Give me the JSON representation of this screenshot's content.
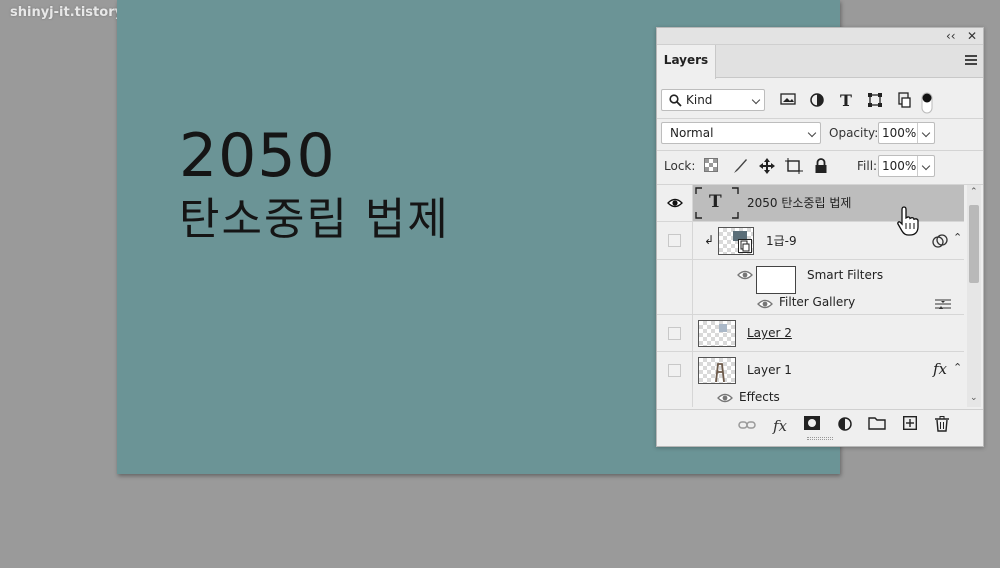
{
  "watermark": "shinyj-it.tistory.com",
  "canvas": {
    "line1": "2050",
    "line2": "탄소중립 법제",
    "background": "#6b9496"
  },
  "panel": {
    "collapse_glyph": "‹‹",
    "close_glyph": "✕",
    "tab_label": "Layers",
    "filter": {
      "kind_label": "Kind",
      "icons": [
        "image-filter-icon",
        "adjustment-filter-icon",
        "type-filter-icon",
        "shape-filter-icon",
        "smart-object-filter-icon",
        "filter-toggle-icon"
      ]
    },
    "blend_mode": "Normal",
    "opacity_label": "Opacity:",
    "opacity_value": "100%",
    "lock_label": "Lock:",
    "fill_label": "Fill:",
    "fill_value": "100%",
    "layers": [
      {
        "name": "2050 탄소중립 법제",
        "type_glyph": "T",
        "selected": true,
        "visible": true
      },
      {
        "name": "1급-9",
        "type": "smart-object",
        "visible": false
      },
      {
        "name": "Smart Filters",
        "type": "smart-filters"
      },
      {
        "name": "Filter Gallery",
        "type": "filter"
      },
      {
        "name": "Layer 2",
        "visible": false
      },
      {
        "name": "Layer 1",
        "visible": false,
        "fx": "fx"
      },
      {
        "name": "Effects",
        "type": "effects"
      }
    ],
    "bottom_fx_label": "fx",
    "selected_row_color": "#bdbdbd"
  }
}
